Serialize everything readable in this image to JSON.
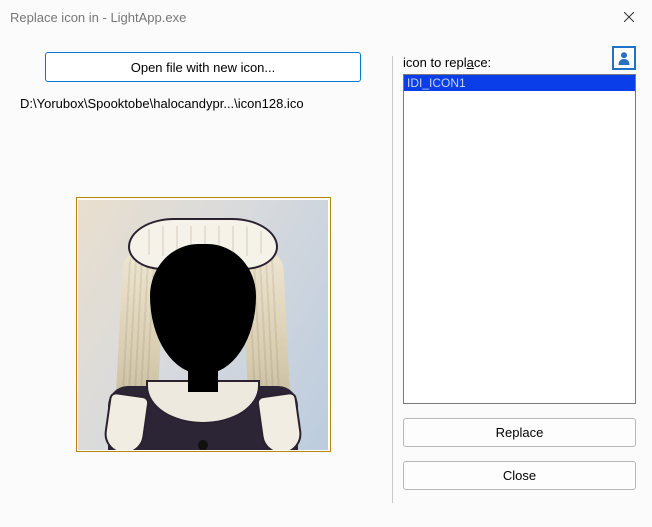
{
  "window": {
    "title": "Replace icon in - LightApp.exe"
  },
  "left": {
    "open_button_label": "Open file with new icon...",
    "file_path": "D:\\Yorubox\\Spooktobe\\halocandypr...\\icon128.ico"
  },
  "right": {
    "label_pre": "icon to repl",
    "label_underlined": "a",
    "label_post": "ce:",
    "list_items": [
      "IDI_ICON1"
    ],
    "replace_label": "Replace",
    "close_label": "Close"
  }
}
